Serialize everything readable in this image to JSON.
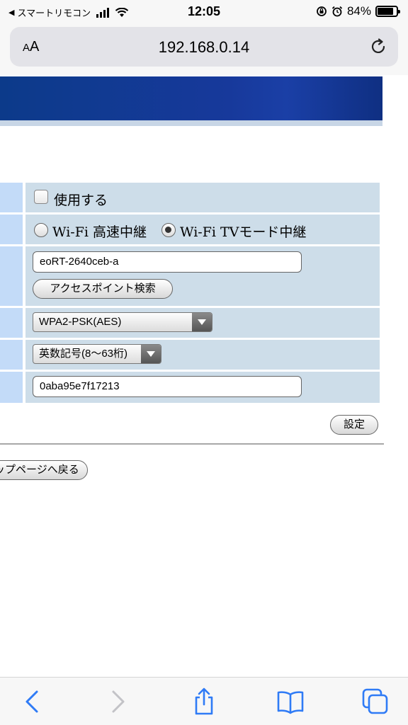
{
  "status_bar": {
    "back_app": "スマートリモコン",
    "time": "12:05",
    "battery_text": "84%",
    "battery_level": 0.84
  },
  "browser": {
    "text_size_label": "AA",
    "url": "192.168.0.14"
  },
  "form": {
    "use_checkbox_label": "使用する",
    "use_checked": false,
    "mode_options": [
      "Wi-Fi 高速中継",
      "Wi-Fi TVモード中継"
    ],
    "mode_selected": "Wi-Fi TVモード中継",
    "ssid_value": "eoRT-2640ceb-a",
    "ap_search_button": "アクセスポイント検索",
    "encryption_selected": "WPA2-PSK(AES)",
    "key_format_selected": "英数記号(8〜63桁)",
    "key_value": "0aba95e7f17213",
    "set_button": "設定",
    "back_to_top_button": "トップページへ戻る"
  },
  "colors": {
    "banner": "#17399b",
    "label_cell": "#c3dbf8",
    "value_cell": "#cddde9",
    "ios_blue": "#2f7bf6"
  },
  "toolbar": {
    "icons": [
      "back-icon",
      "forward-icon",
      "share-icon",
      "bookmarks-icon",
      "tabs-icon"
    ]
  }
}
